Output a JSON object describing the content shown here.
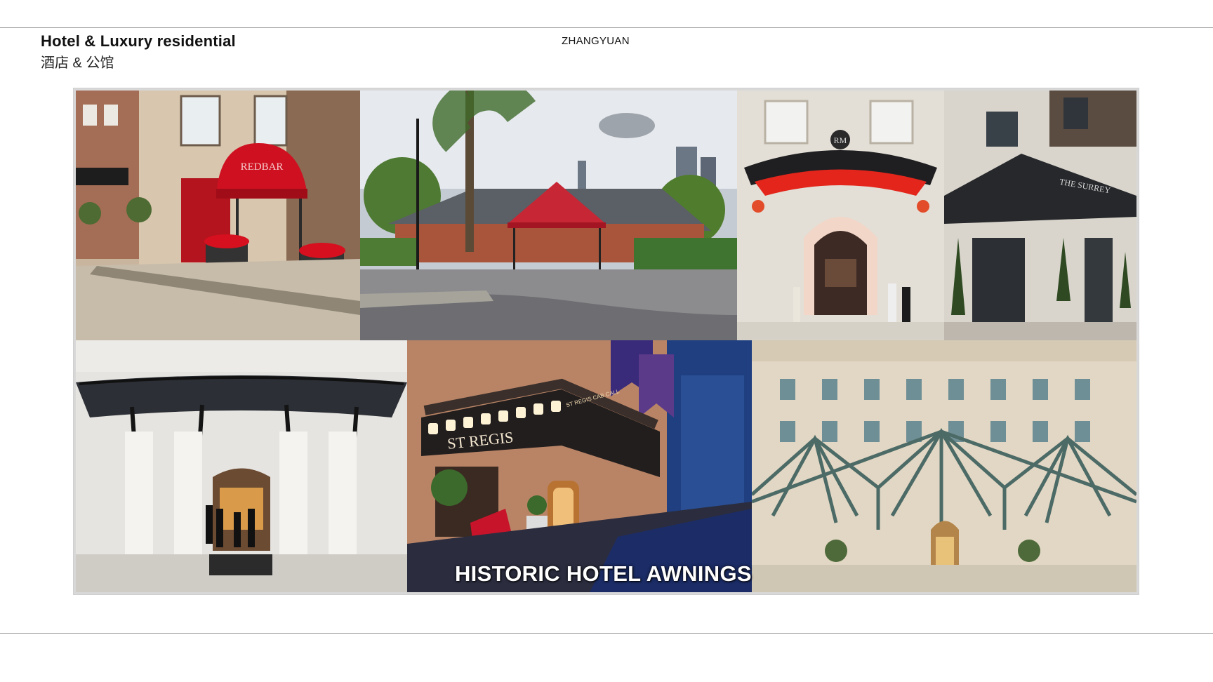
{
  "header": {
    "title_en": "Hotel & Luxury residential",
    "title_zh": "酒店 & 公馆",
    "brand": "ZHANGYUAN"
  },
  "collage": {
    "overlay_text": "HISTORIC HOTEL AWNINGS",
    "photos": [
      {
        "name": "redbar-awning",
        "sign": "REDBAR"
      },
      {
        "name": "tavern-on-the-green-awning"
      },
      {
        "name": "le-royal-monceau-awning",
        "monogram": "RM"
      },
      {
        "name": "the-surrey-canopy",
        "sign": "THE SURREY"
      },
      {
        "name": "glass-marquee-colonnade"
      },
      {
        "name": "st-regis-marquee",
        "sign": "ST REGIS",
        "sign_small": "ST REGIS CAB CALL"
      },
      {
        "name": "steel-glass-canopy-facade"
      }
    ]
  },
  "colors": {
    "awning_red": "#c8102e",
    "rule_gray": "#9a9a9a",
    "text": "#111111"
  }
}
